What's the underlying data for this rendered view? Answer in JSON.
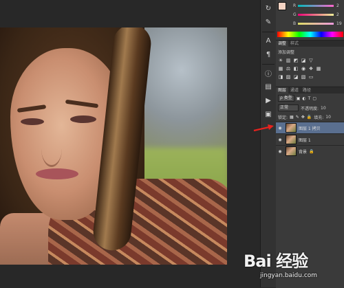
{
  "color_panel": {
    "r_label": "R",
    "g_label": "G",
    "b_label": "B",
    "r_value": "2",
    "g_value": "2",
    "b_value": "19",
    "fg_color": "#f4d3c3",
    "bg_color": "#e9b9a4"
  },
  "adjustments_panel": {
    "tabs": [
      "调整",
      "样式"
    ],
    "title": "添加调整"
  },
  "layers_panel": {
    "tabs": [
      "图层",
      "通道",
      "路径"
    ],
    "kind_label": "ρ 类型",
    "blend_mode": "正常",
    "opacity_label": "不透明度:",
    "opacity_value": "10",
    "lock_label": "锁定:",
    "fill_label": "填充:",
    "fill_value": "10",
    "layers": [
      {
        "name": "图层 1 拷贝",
        "selected": true
      },
      {
        "name": "图层 1",
        "selected": false
      },
      {
        "name": "背景",
        "selected": false
      }
    ]
  },
  "watermark": {
    "main": "Bai 经验",
    "url": "jingyan.baidu.com"
  }
}
